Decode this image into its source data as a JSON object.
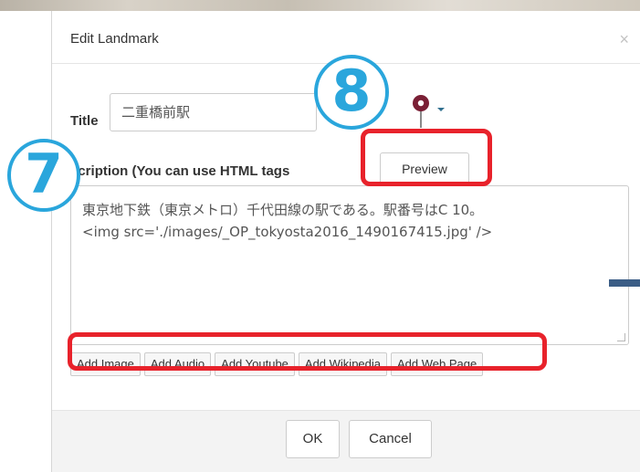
{
  "modal": {
    "title": "Edit Landmark",
    "close_glyph": "×"
  },
  "form": {
    "title_label": "Title",
    "title_value": "二重橋前駅",
    "description_label": "scription (You can use HTML tags",
    "preview_button": "Preview",
    "description_lines": [
      "東京地下鉄（東京メトロ）千代田線の駅である。駅番号はC 10。",
      "<img src='./images/_OP_tokyosta2016_1490167415.jpg' />"
    ],
    "add_buttons": [
      "Add Image",
      "Add Audio",
      "Add Youtube",
      "Add Wikipedia",
      "Add Web Page"
    ]
  },
  "footer": {
    "ok_label": "OK",
    "cancel_label": "Cancel"
  },
  "annotations": {
    "badge_7": "7",
    "badge_8": "8",
    "badge_color": "#2aa6dc",
    "highlight_color": "#e8222b"
  },
  "icons": {
    "marker": "map-pin-icon",
    "close": "close-icon",
    "caret": "caret-down-icon"
  }
}
